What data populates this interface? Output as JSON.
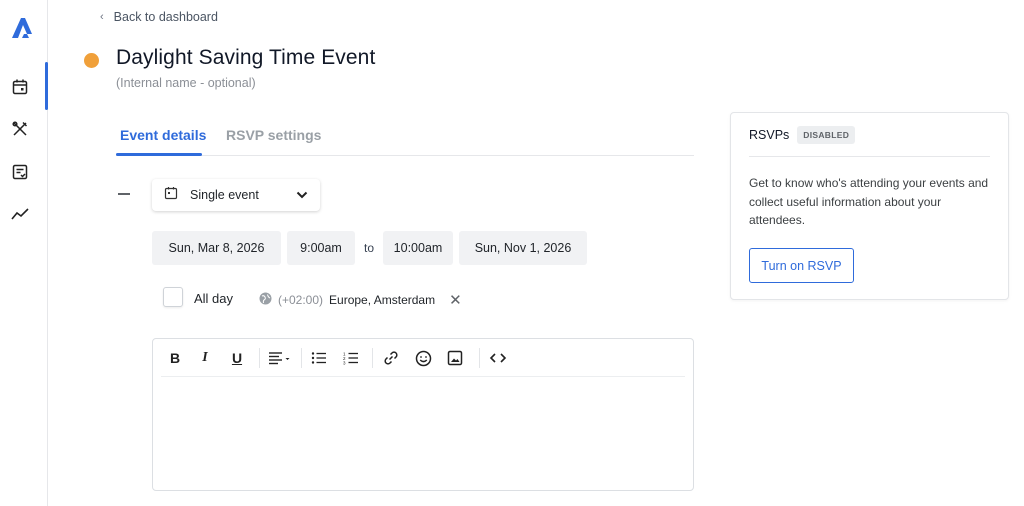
{
  "nav": {
    "back_label": "Back to dashboard"
  },
  "event": {
    "title": "Daylight Saving Time Event",
    "internal_placeholder": "(Internal name - optional)",
    "status_color": "#f0a03a"
  },
  "tabs": [
    {
      "label": "Event details",
      "active": true
    },
    {
      "label": "RSVP settings",
      "active": false
    }
  ],
  "event_type": {
    "selected": "Single event"
  },
  "schedule": {
    "start_date": "Sun, Mar 8, 2026",
    "start_time": "9:00am",
    "separator": "to",
    "end_time": "10:00am",
    "end_date": "Sun, Nov 1, 2026"
  },
  "all_day": {
    "label": "All day",
    "checked": false
  },
  "timezone": {
    "offset": "(+02:00)",
    "name": "Europe, Amsterdam"
  },
  "editor": {
    "toolbar": [
      "bold-icon",
      "italic-icon",
      "underline-icon",
      "align-icon",
      "bullet-list-icon",
      "numbered-list-icon",
      "link-icon",
      "emoji-icon",
      "image-icon",
      "code-icon"
    ],
    "content": ""
  },
  "rsvp_panel": {
    "title": "RSVPs",
    "badge": "DISABLED",
    "description": "Get to know who's attending your events and collect useful information about your attendees.",
    "button_label": "Turn on RSVP"
  },
  "colors": {
    "accent": "#2f6bdb",
    "status": "#f0a03a"
  }
}
